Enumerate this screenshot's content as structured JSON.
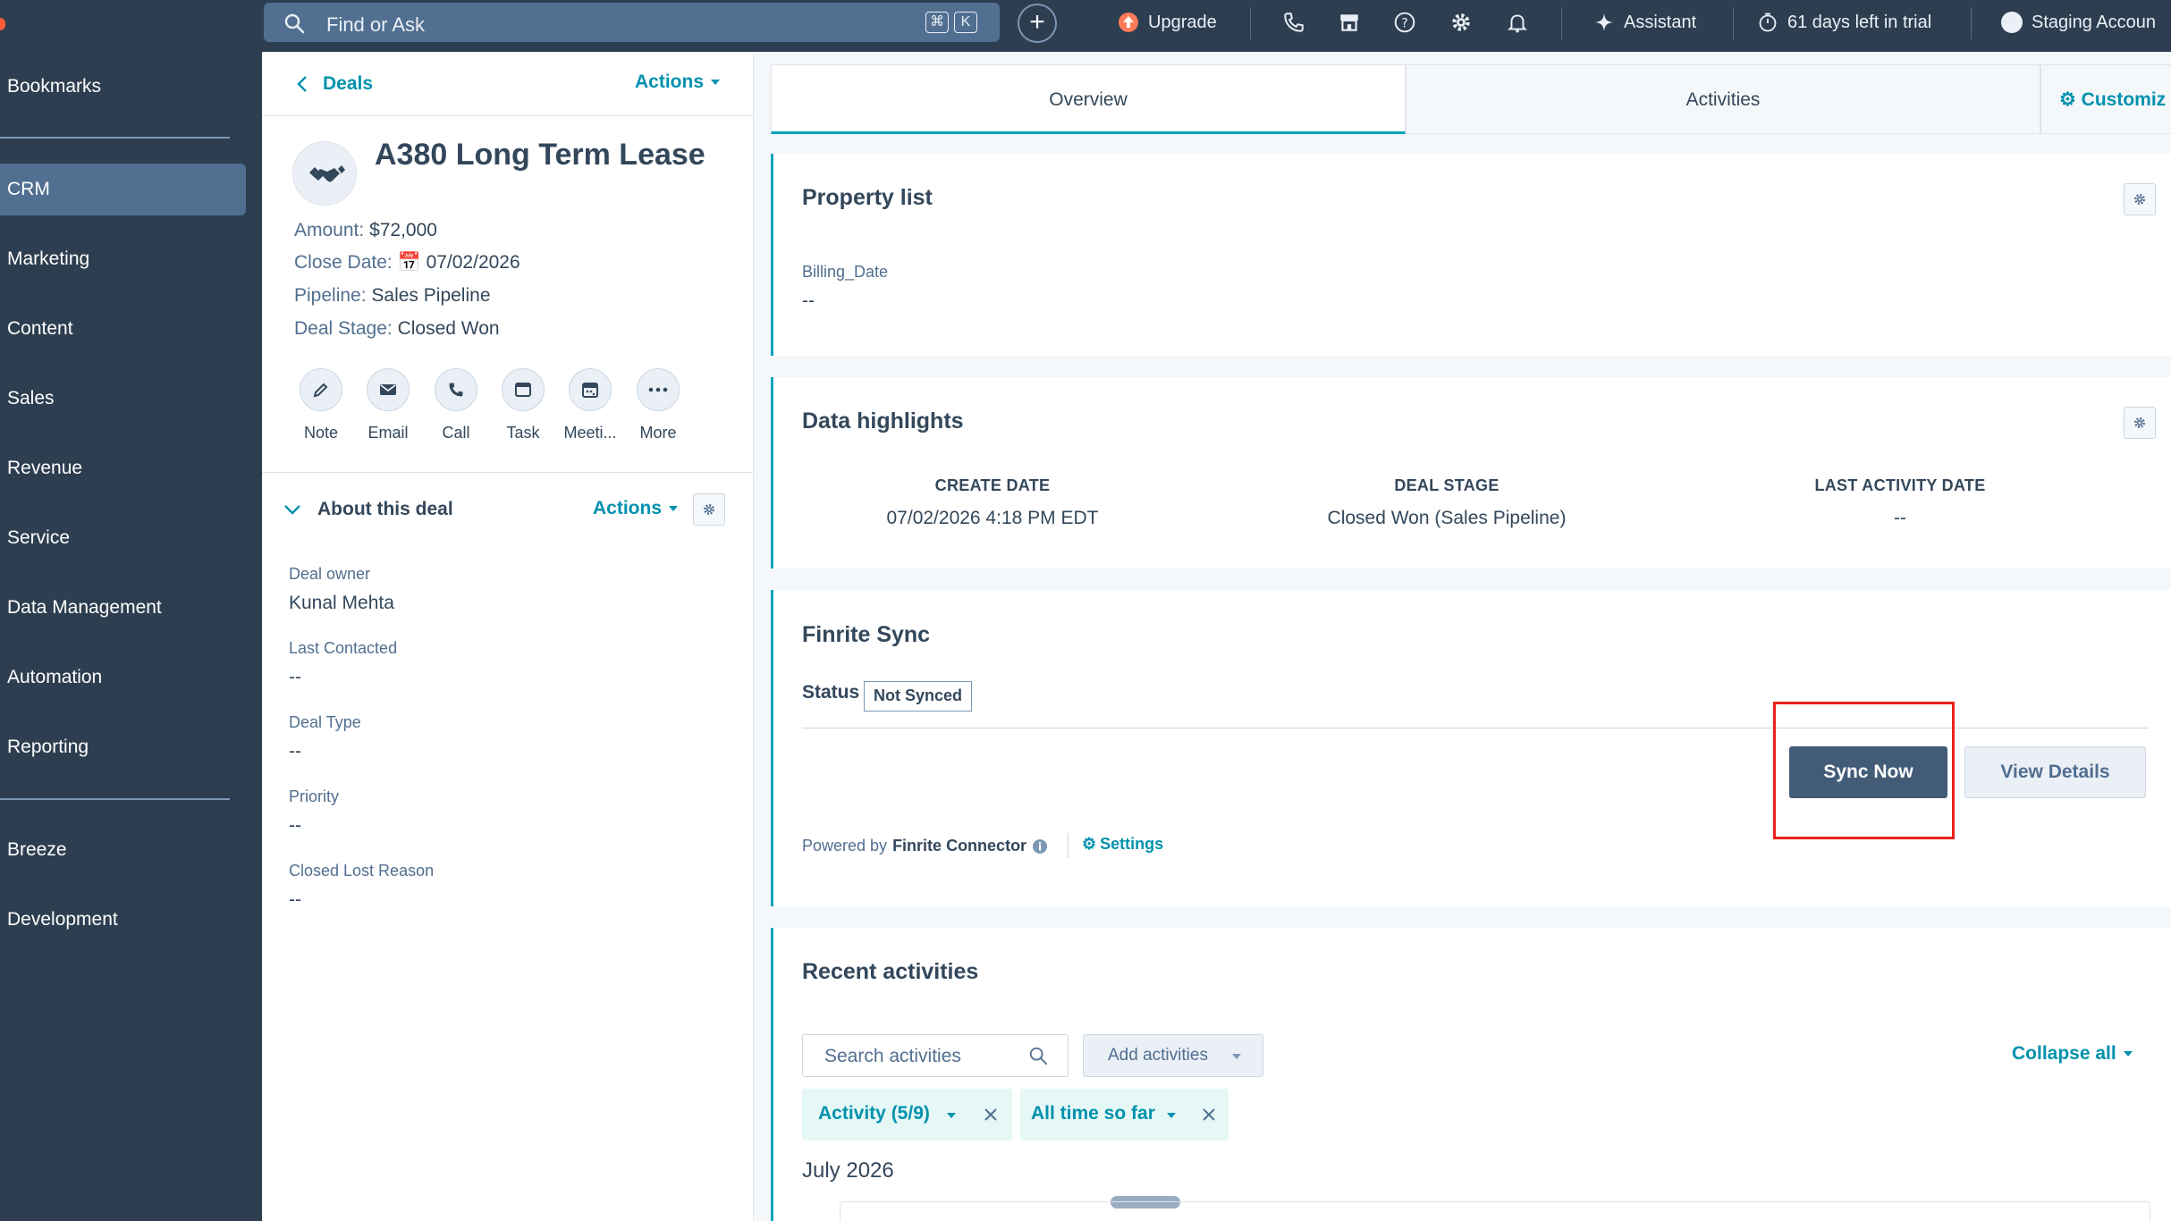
{
  "topbar": {
    "search_placeholder": "Find or Ask",
    "shortcut_keys": [
      "⌘",
      "K"
    ],
    "upgrade_label": "Upgrade",
    "assistant_label": "Assistant",
    "trial_label": "61 days left in trial",
    "account_label": "Staging Accoun"
  },
  "nav": {
    "items": [
      "Bookmarks",
      "CRM",
      "Marketing",
      "Content",
      "Sales",
      "Revenue",
      "Service",
      "Data Management",
      "Automation",
      "Reporting",
      "Breeze",
      "Development"
    ],
    "active": "CRM"
  },
  "record": {
    "back_label": "Deals",
    "actions_label": "Actions",
    "title": "A380 Long Term Lease",
    "amount_label": "Amount:",
    "amount": "$72,000",
    "close_date_label": "Close Date:",
    "close_date": "07/02/2026",
    "pipeline_label": "Pipeline:",
    "pipeline": "Sales Pipeline",
    "stage_label": "Deal Stage:",
    "stage": "Closed Won",
    "quick_actions": [
      "Note",
      "Email",
      "Call",
      "Task",
      "Meeti...",
      "More"
    ],
    "about": {
      "title": "About this deal",
      "actions_label": "Actions",
      "fields": [
        {
          "label": "Deal owner",
          "value": "Kunal Mehta"
        },
        {
          "label": "Last Contacted",
          "value": "--"
        },
        {
          "label": "Deal Type",
          "value": "--"
        },
        {
          "label": "Priority",
          "value": "--"
        },
        {
          "label": "Closed Lost Reason",
          "value": "--"
        }
      ]
    }
  },
  "tabs": {
    "overview": "Overview",
    "activities": "Activities",
    "customize": "Customiz"
  },
  "property_list": {
    "title": "Property list",
    "field_label": "Billing_Date",
    "field_value": "--"
  },
  "data_highlights": {
    "title": "Data highlights",
    "columns": [
      {
        "label": "CREATE DATE",
        "value": "07/02/2026 4:18 PM EDT"
      },
      {
        "label": "DEAL STAGE",
        "value": "Closed Won (Sales Pipeline)"
      },
      {
        "label": "LAST ACTIVITY DATE",
        "value": "--"
      }
    ]
  },
  "finrite": {
    "title": "Finrite Sync",
    "status_label": "Status",
    "status_value": "Not Synced",
    "sync_button": "Sync Now",
    "details_button": "View Details",
    "powered_prefix": "Powered by",
    "powered_name": "Finrite Connector",
    "settings_label": "Settings"
  },
  "recent": {
    "title": "Recent activities",
    "search_placeholder": "Search activities",
    "add_label": "Add activities",
    "collapse_label": "Collapse all",
    "filter_activity": "Activity (5/9)",
    "filter_time": "All time so far",
    "month_label": "July 2026"
  },
  "colors": {
    "nav_bg": "#2d3e50",
    "accent": "#00a4bd",
    "link": "#0091ae",
    "primary_button": "#425b76",
    "highlight_box": "#e8221b"
  }
}
